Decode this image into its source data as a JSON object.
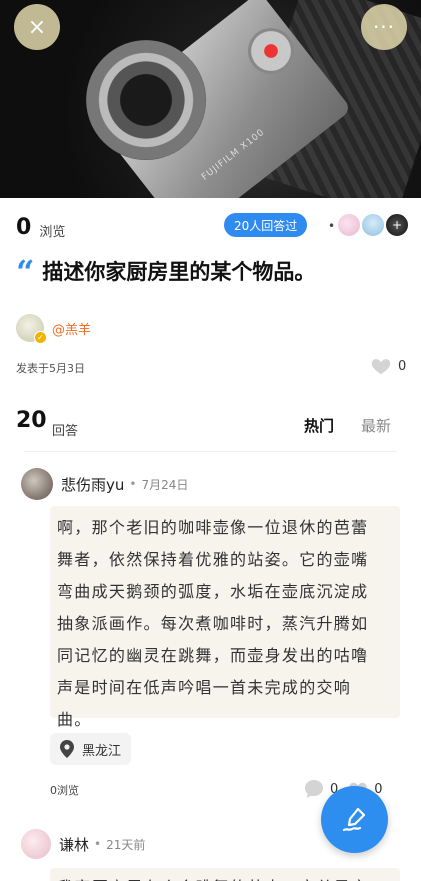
{
  "header": {
    "close_icon": "×",
    "more_icon": "···",
    "camera_brand": "FUJIFILM X100"
  },
  "stats": {
    "views": "0",
    "views_label": "浏览",
    "answered_badge": "20人回答过",
    "separator": "•",
    "avatar3_glyph": "+"
  },
  "question": {
    "quote_mark": "“",
    "text": "描述你家厨房里的某个物品。"
  },
  "author": {
    "name": "@羔羊",
    "badge": "✓"
  },
  "post": {
    "date": "发表于5月3日",
    "likes": "0"
  },
  "answers_section": {
    "count": "20",
    "label": "回答",
    "tab_hot": "热门",
    "tab_new": "最新"
  },
  "answers": [
    {
      "user": "悲伤雨yu",
      "separator": "•",
      "time": "7月24日",
      "lines": [
        "啊，那个老旧的咖啡壶像一位退休的芭蕾",
        "舞者，依然保持着优雅的站姿。它的壶嘴",
        "弯曲成天鹅颈的弧度，水垢在壶底沉淀成",
        "抽象派画作。每次煮咖啡时，蒸汽升腾如",
        "同记忆的幽灵在跳舞，而壶身发出的咕噜",
        "声是时间在低声吟唱一首未完成的交响",
        "曲。"
      ],
      "location": "黑龙江",
      "views": "0浏览",
      "comments": "0",
      "likes": "0"
    },
    {
      "user": "谦林",
      "separator": "•",
      "time": "21天前",
      "preview": "我家厨房里有个会跳舞的茶壶！它总是穿"
    }
  ],
  "colors": {
    "accent": "#2f8bf0",
    "author": "#f36b23",
    "card_bg": "#f7f4ee"
  },
  "icons": {
    "close": "close-icon",
    "more": "more-icon",
    "heart": "heart-icon",
    "comment": "comment-icon",
    "location": "location-pin-icon",
    "compose": "compose-icon"
  }
}
